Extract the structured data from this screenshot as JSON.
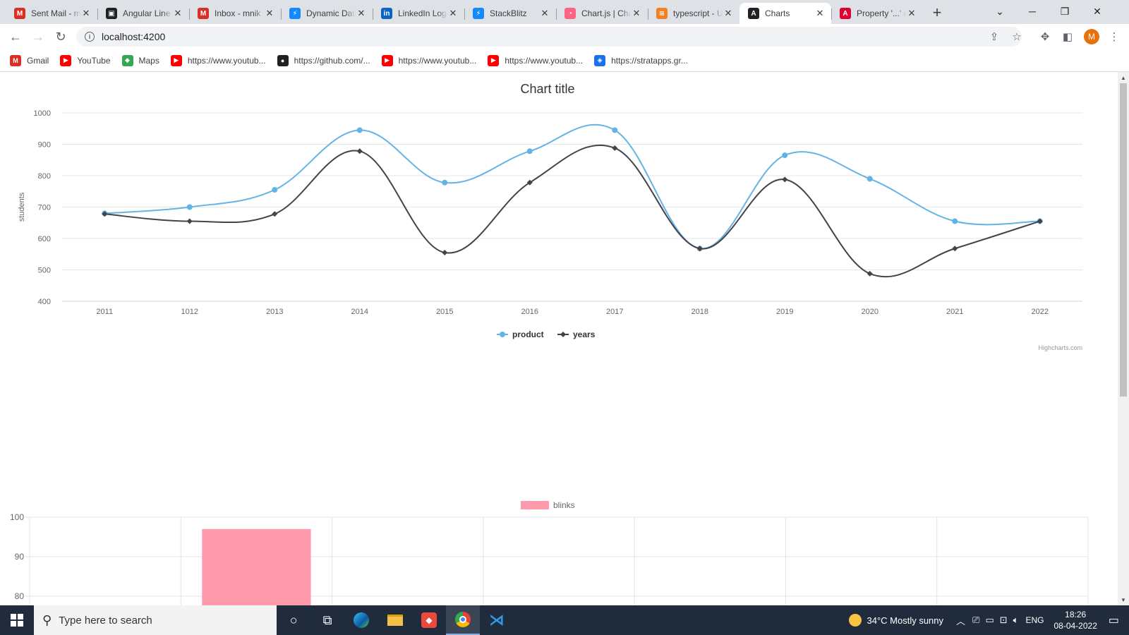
{
  "browser": {
    "tabs": [
      {
        "label": "Sent Mail - mnik",
        "icon": "gmail-icon",
        "color": "#d93025",
        "glyph": "M"
      },
      {
        "label": "Angular Line Chart",
        "icon": "angular-icon",
        "color": "#202124",
        "glyph": "▣"
      },
      {
        "label": "Inbox - mnik",
        "icon": "gmail-icon",
        "color": "#d93025",
        "glyph": "M"
      },
      {
        "label": "Dynamic Data",
        "icon": "stackblitz-icon",
        "color": "#1389fd",
        "glyph": "⚡"
      },
      {
        "label": "LinkedIn Login",
        "icon": "linkedin-icon",
        "color": "#0a66c2",
        "glyph": "in"
      },
      {
        "label": "StackBlitz",
        "icon": "stackblitz-icon",
        "color": "#1389fd",
        "glyph": "⚡"
      },
      {
        "label": "Chart.js | Chart.js",
        "icon": "chartjs-icon",
        "color": "#ff6384",
        "glyph": "◔"
      },
      {
        "label": "typescript - Uncaught",
        "icon": "stackoverflow-icon",
        "color": "#f48024",
        "glyph": "≋"
      },
      {
        "label": "Charts",
        "icon": "angular-icon",
        "color": "#202124",
        "glyph": "A",
        "active": true
      },
      {
        "label": "Property '...' does",
        "icon": "angular-red-icon",
        "color": "#dd0031",
        "glyph": "A"
      }
    ],
    "new_tab_label": "+",
    "url": "localhost:4200",
    "avatar_letter": "M",
    "bookmarks": [
      {
        "label": "Gmail",
        "icon": "gmail-icon",
        "color": "#d93025",
        "glyph": "M"
      },
      {
        "label": "YouTube",
        "icon": "youtube-icon",
        "color": "#ff0000",
        "glyph": "▶"
      },
      {
        "label": "Maps",
        "icon": "maps-icon",
        "color": "#34a853",
        "glyph": "◆"
      },
      {
        "label": "https://www.youtub...",
        "icon": "youtube-icon",
        "color": "#ff0000",
        "glyph": "▶"
      },
      {
        "label": "https://github.com/...",
        "icon": "github-icon",
        "color": "#202124",
        "glyph": "●"
      },
      {
        "label": "https://www.youtub...",
        "icon": "youtube-icon",
        "color": "#ff0000",
        "glyph": "▶"
      },
      {
        "label": "https://www.youtub...",
        "icon": "youtube-icon",
        "color": "#ff0000",
        "glyph": "▶"
      },
      {
        "label": "https://stratapps.gr...",
        "icon": "stratapps-icon",
        "color": "#1a73e8",
        "glyph": "◈"
      }
    ]
  },
  "chart_data": [
    {
      "type": "line",
      "title": "Chart title",
      "ylabel": "students",
      "xlabel": "",
      "categories": [
        "2011",
        "1012",
        "2013",
        "2014",
        "2015",
        "2016",
        "2017",
        "2018",
        "2019",
        "2020",
        "2021",
        "2022"
      ],
      "ylim": [
        400,
        1000
      ],
      "yticks": [
        400,
        500,
        600,
        700,
        800,
        900,
        1000
      ],
      "grid": true,
      "legend": "bottom-center",
      "credits": "Highcharts.com",
      "series": [
        {
          "name": "product",
          "color": "#63b4e6",
          "marker": "circle",
          "values": [
            680,
            700,
            755,
            945,
            778,
            878,
            945,
            568,
            865,
            790,
            655,
            655
          ]
        },
        {
          "name": "years",
          "color": "#434348",
          "marker": "diamond",
          "values": [
            678,
            655,
            678,
            878,
            555,
            778,
            888,
            568,
            788,
            488,
            568,
            655
          ]
        }
      ]
    },
    {
      "type": "bar",
      "title": "",
      "legend": "top-center",
      "ylim": [
        80,
        100
      ],
      "yticks": [
        80,
        90,
        100
      ],
      "grid": true,
      "series": [
        {
          "name": "blinks",
          "color": "#ff9aad",
          "values": [
            null,
            97
          ]
        }
      ]
    }
  ],
  "taskbar": {
    "search_placeholder": "Type here to search",
    "weather": "34°C  Mostly sunny",
    "language": "ENG",
    "time": "18:26",
    "date": "08-04-2022"
  }
}
